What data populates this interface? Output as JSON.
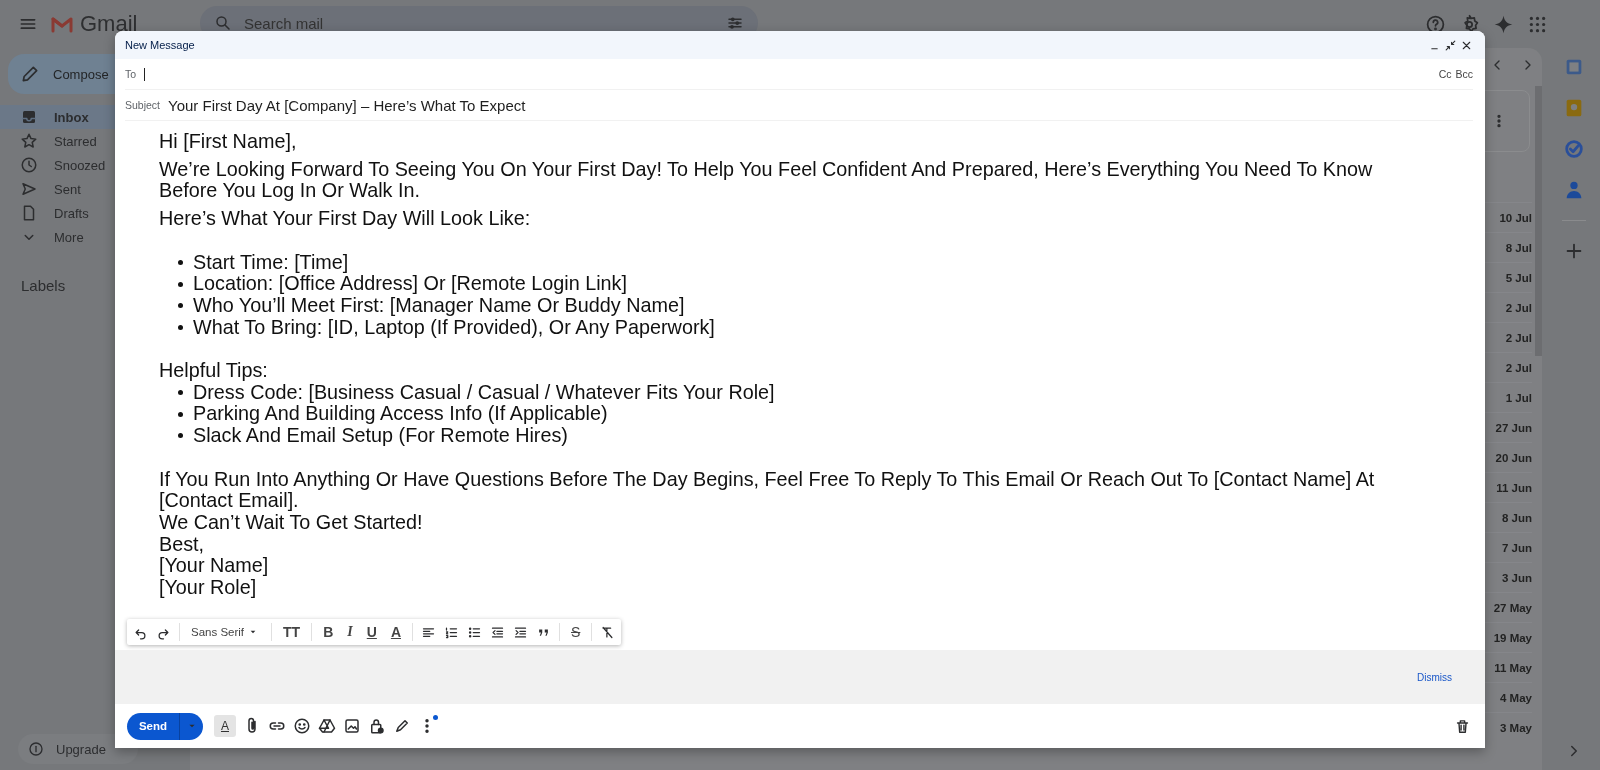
{
  "header": {
    "app_name": "Gmail",
    "search": {
      "placeholder": "Search mail"
    }
  },
  "sidebar": {
    "compose": "Compose",
    "items": [
      {
        "label": "Inbox",
        "selected": true,
        "kind": "inbox"
      },
      {
        "label": "Starred",
        "selected": false,
        "kind": "star"
      },
      {
        "label": "Snoozed",
        "selected": false,
        "kind": "clock"
      },
      {
        "label": "Sent",
        "selected": false,
        "kind": "send"
      },
      {
        "label": "Drafts",
        "selected": false,
        "kind": "file"
      },
      {
        "label": "More",
        "selected": false,
        "kind": "chevron"
      }
    ],
    "labels_heading": "Labels",
    "upgrade": "Upgrade"
  },
  "mail_list": {
    "dates": [
      "10 Jul",
      "8 Jul",
      "5 Jul",
      "2 Jul",
      "2 Jul",
      "2 Jul",
      "1 Jul",
      "27 Jun",
      "20 Jun",
      "11 Jun",
      "8 Jun",
      "7 Jun",
      "3 Jun",
      "27 May",
      "19 May",
      "11 May",
      "4 May",
      "3 May"
    ]
  },
  "compose": {
    "title": "New Message",
    "to_label": "To",
    "cc": "Cc",
    "bcc": "Bcc",
    "subject_label": "Subject",
    "subject": "Your First Day At [Company] – Here’s What To Expect",
    "body": [
      {
        "kind": "paragraph",
        "text": "Hi [First Name],"
      },
      {
        "kind": "paragraph",
        "text": "We’re Looking Forward To Seeing You On Your First Day! To Help You Feel Confident And Prepared, Here’s Everything You Need To Know Before You Log In Or Walk In."
      },
      {
        "kind": "line",
        "text": "Here’s What Your First Day Will Look Like:"
      },
      {
        "kind": "blank"
      },
      {
        "kind": "list",
        "items": [
          "Start Time: [Time]",
          "Location: [Office Address] Or [Remote Login Link]",
          "Who You’ll Meet First: [Manager Name Or Buddy Name]",
          "What To Bring: [ID, Laptop (If Provided), Or Any Paperwork]"
        ]
      },
      {
        "kind": "blank"
      },
      {
        "kind": "line",
        "text": "Helpful Tips:"
      },
      {
        "kind": "list",
        "items": [
          "Dress Code: [Business Casual / Casual / Whatever Fits Your Role]",
          "Parking And Building Access Info (If Applicable)",
          "Slack And Email Setup (For Remote Hires)"
        ]
      },
      {
        "kind": "blank"
      },
      {
        "kind": "line",
        "text": "If You Run Into Anything Or Have Questions Before The Day Begins, Feel Free To Reply To This Email Or Reach Out To [Contact Name] At [Contact Email]."
      },
      {
        "kind": "line",
        "text": "We Can’t Wait To Get Started!"
      },
      {
        "kind": "line",
        "text": "Best,"
      },
      {
        "kind": "line",
        "text": "[Your Name]"
      },
      {
        "kind": "line",
        "text": "[Your Role]"
      }
    ],
    "format_toolbar": {
      "font": "Sans Serif",
      "size_glyph": "TT",
      "bold_glyph": "B",
      "italic_glyph": "I",
      "underline_glyph": "U",
      "color_glyph": "A",
      "strike_glyph": "S"
    },
    "notice": {
      "action": "Dismiss"
    },
    "send": "Send",
    "format_glyph": "A"
  }
}
